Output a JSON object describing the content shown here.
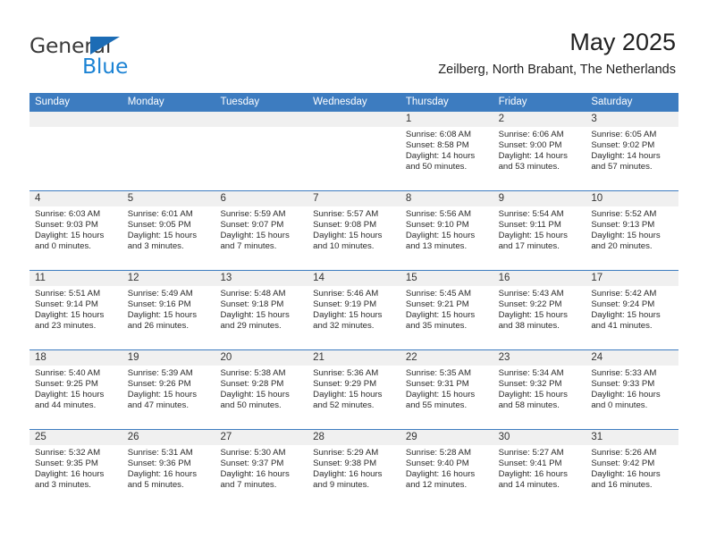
{
  "brand": {
    "name_top": "General",
    "name_bottom": "Blue",
    "accent_color": "#1c83d4",
    "triangle_color": "#1c6cb5"
  },
  "header": {
    "month_title": "May 2025",
    "location": "Zeilberg, North Brabant, The Netherlands"
  },
  "theme": {
    "header_blue": "#3d7cc0",
    "day_band_gray": "#f0f0f0",
    "text_color": "#2b2b2b"
  },
  "calendar": {
    "weekdays": [
      "Sunday",
      "Monday",
      "Tuesday",
      "Wednesday",
      "Thursday",
      "Friday",
      "Saturday"
    ],
    "weeks": [
      [
        {
          "day": "",
          "empty": true,
          "sunrise": "",
          "sunset": "",
          "daylight_line1": "",
          "daylight_line2": ""
        },
        {
          "day": "",
          "empty": true,
          "sunrise": "",
          "sunset": "",
          "daylight_line1": "",
          "daylight_line2": ""
        },
        {
          "day": "",
          "empty": true,
          "sunrise": "",
          "sunset": "",
          "daylight_line1": "",
          "daylight_line2": ""
        },
        {
          "day": "",
          "empty": true,
          "sunrise": "",
          "sunset": "",
          "daylight_line1": "",
          "daylight_line2": ""
        },
        {
          "day": "1",
          "empty": false,
          "sunrise": "Sunrise: 6:08 AM",
          "sunset": "Sunset: 8:58 PM",
          "daylight_line1": "Daylight: 14 hours",
          "daylight_line2": "and 50 minutes."
        },
        {
          "day": "2",
          "empty": false,
          "sunrise": "Sunrise: 6:06 AM",
          "sunset": "Sunset: 9:00 PM",
          "daylight_line1": "Daylight: 14 hours",
          "daylight_line2": "and 53 minutes."
        },
        {
          "day": "3",
          "empty": false,
          "sunrise": "Sunrise: 6:05 AM",
          "sunset": "Sunset: 9:02 PM",
          "daylight_line1": "Daylight: 14 hours",
          "daylight_line2": "and 57 minutes."
        }
      ],
      [
        {
          "day": "4",
          "empty": false,
          "sunrise": "Sunrise: 6:03 AM",
          "sunset": "Sunset: 9:03 PM",
          "daylight_line1": "Daylight: 15 hours",
          "daylight_line2": "and 0 minutes."
        },
        {
          "day": "5",
          "empty": false,
          "sunrise": "Sunrise: 6:01 AM",
          "sunset": "Sunset: 9:05 PM",
          "daylight_line1": "Daylight: 15 hours",
          "daylight_line2": "and 3 minutes."
        },
        {
          "day": "6",
          "empty": false,
          "sunrise": "Sunrise: 5:59 AM",
          "sunset": "Sunset: 9:07 PM",
          "daylight_line1": "Daylight: 15 hours",
          "daylight_line2": "and 7 minutes."
        },
        {
          "day": "7",
          "empty": false,
          "sunrise": "Sunrise: 5:57 AM",
          "sunset": "Sunset: 9:08 PM",
          "daylight_line1": "Daylight: 15 hours",
          "daylight_line2": "and 10 minutes."
        },
        {
          "day": "8",
          "empty": false,
          "sunrise": "Sunrise: 5:56 AM",
          "sunset": "Sunset: 9:10 PM",
          "daylight_line1": "Daylight: 15 hours",
          "daylight_line2": "and 13 minutes."
        },
        {
          "day": "9",
          "empty": false,
          "sunrise": "Sunrise: 5:54 AM",
          "sunset": "Sunset: 9:11 PM",
          "daylight_line1": "Daylight: 15 hours",
          "daylight_line2": "and 17 minutes."
        },
        {
          "day": "10",
          "empty": false,
          "sunrise": "Sunrise: 5:52 AM",
          "sunset": "Sunset: 9:13 PM",
          "daylight_line1": "Daylight: 15 hours",
          "daylight_line2": "and 20 minutes."
        }
      ],
      [
        {
          "day": "11",
          "empty": false,
          "sunrise": "Sunrise: 5:51 AM",
          "sunset": "Sunset: 9:14 PM",
          "daylight_line1": "Daylight: 15 hours",
          "daylight_line2": "and 23 minutes."
        },
        {
          "day": "12",
          "empty": false,
          "sunrise": "Sunrise: 5:49 AM",
          "sunset": "Sunset: 9:16 PM",
          "daylight_line1": "Daylight: 15 hours",
          "daylight_line2": "and 26 minutes."
        },
        {
          "day": "13",
          "empty": false,
          "sunrise": "Sunrise: 5:48 AM",
          "sunset": "Sunset: 9:18 PM",
          "daylight_line1": "Daylight: 15 hours",
          "daylight_line2": "and 29 minutes."
        },
        {
          "day": "14",
          "empty": false,
          "sunrise": "Sunrise: 5:46 AM",
          "sunset": "Sunset: 9:19 PM",
          "daylight_line1": "Daylight: 15 hours",
          "daylight_line2": "and 32 minutes."
        },
        {
          "day": "15",
          "empty": false,
          "sunrise": "Sunrise: 5:45 AM",
          "sunset": "Sunset: 9:21 PM",
          "daylight_line1": "Daylight: 15 hours",
          "daylight_line2": "and 35 minutes."
        },
        {
          "day": "16",
          "empty": false,
          "sunrise": "Sunrise: 5:43 AM",
          "sunset": "Sunset: 9:22 PM",
          "daylight_line1": "Daylight: 15 hours",
          "daylight_line2": "and 38 minutes."
        },
        {
          "day": "17",
          "empty": false,
          "sunrise": "Sunrise: 5:42 AM",
          "sunset": "Sunset: 9:24 PM",
          "daylight_line1": "Daylight: 15 hours",
          "daylight_line2": "and 41 minutes."
        }
      ],
      [
        {
          "day": "18",
          "empty": false,
          "sunrise": "Sunrise: 5:40 AM",
          "sunset": "Sunset: 9:25 PM",
          "daylight_line1": "Daylight: 15 hours",
          "daylight_line2": "and 44 minutes."
        },
        {
          "day": "19",
          "empty": false,
          "sunrise": "Sunrise: 5:39 AM",
          "sunset": "Sunset: 9:26 PM",
          "daylight_line1": "Daylight: 15 hours",
          "daylight_line2": "and 47 minutes."
        },
        {
          "day": "20",
          "empty": false,
          "sunrise": "Sunrise: 5:38 AM",
          "sunset": "Sunset: 9:28 PM",
          "daylight_line1": "Daylight: 15 hours",
          "daylight_line2": "and 50 minutes."
        },
        {
          "day": "21",
          "empty": false,
          "sunrise": "Sunrise: 5:36 AM",
          "sunset": "Sunset: 9:29 PM",
          "daylight_line1": "Daylight: 15 hours",
          "daylight_line2": "and 52 minutes."
        },
        {
          "day": "22",
          "empty": false,
          "sunrise": "Sunrise: 5:35 AM",
          "sunset": "Sunset: 9:31 PM",
          "daylight_line1": "Daylight: 15 hours",
          "daylight_line2": "and 55 minutes."
        },
        {
          "day": "23",
          "empty": false,
          "sunrise": "Sunrise: 5:34 AM",
          "sunset": "Sunset: 9:32 PM",
          "daylight_line1": "Daylight: 15 hours",
          "daylight_line2": "and 58 minutes."
        },
        {
          "day": "24",
          "empty": false,
          "sunrise": "Sunrise: 5:33 AM",
          "sunset": "Sunset: 9:33 PM",
          "daylight_line1": "Daylight: 16 hours",
          "daylight_line2": "and 0 minutes."
        }
      ],
      [
        {
          "day": "25",
          "empty": false,
          "sunrise": "Sunrise: 5:32 AM",
          "sunset": "Sunset: 9:35 PM",
          "daylight_line1": "Daylight: 16 hours",
          "daylight_line2": "and 3 minutes."
        },
        {
          "day": "26",
          "empty": false,
          "sunrise": "Sunrise: 5:31 AM",
          "sunset": "Sunset: 9:36 PM",
          "daylight_line1": "Daylight: 16 hours",
          "daylight_line2": "and 5 minutes."
        },
        {
          "day": "27",
          "empty": false,
          "sunrise": "Sunrise: 5:30 AM",
          "sunset": "Sunset: 9:37 PM",
          "daylight_line1": "Daylight: 16 hours",
          "daylight_line2": "and 7 minutes."
        },
        {
          "day": "28",
          "empty": false,
          "sunrise": "Sunrise: 5:29 AM",
          "sunset": "Sunset: 9:38 PM",
          "daylight_line1": "Daylight: 16 hours",
          "daylight_line2": "and 9 minutes."
        },
        {
          "day": "29",
          "empty": false,
          "sunrise": "Sunrise: 5:28 AM",
          "sunset": "Sunset: 9:40 PM",
          "daylight_line1": "Daylight: 16 hours",
          "daylight_line2": "and 12 minutes."
        },
        {
          "day": "30",
          "empty": false,
          "sunrise": "Sunrise: 5:27 AM",
          "sunset": "Sunset: 9:41 PM",
          "daylight_line1": "Daylight: 16 hours",
          "daylight_line2": "and 14 minutes."
        },
        {
          "day": "31",
          "empty": false,
          "sunrise": "Sunrise: 5:26 AM",
          "sunset": "Sunset: 9:42 PM",
          "daylight_line1": "Daylight: 16 hours",
          "daylight_line2": "and 16 minutes."
        }
      ]
    ]
  }
}
